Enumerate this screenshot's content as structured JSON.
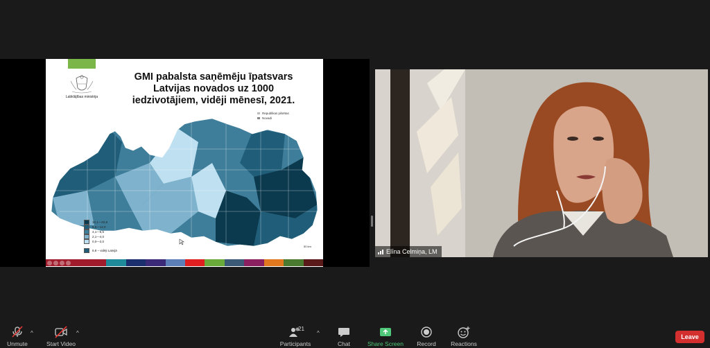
{
  "shared_screen": {
    "slide": {
      "ministry_name": "Labklājības ministrija",
      "title": "GMI pabalsta saņēmēju īpatsvars Latvijas novados uz 1000 iedzivotājiem, vidēji mēnesī, 2021.",
      "top_legend": [
        "Republikas pilsētas",
        "Novadi"
      ],
      "bottom_legend": [
        {
          "label": "12,1—22,8",
          "color": "#0b3a4f"
        },
        {
          "label": "6,6—12,0",
          "color": "#1f5d79"
        },
        {
          "label": "4,1—6,5",
          "color": "#3f7e9a"
        },
        {
          "label": "2,1—4,0",
          "color": "#7fb3cd"
        },
        {
          "label": "0,0—2,0",
          "color": "#bfe0f0"
        }
      ],
      "average_label": "6,8 – vidēji Latvijā",
      "scale_label": "50 km",
      "strip_colors": [
        "#1f8a9a",
        "#1b2f6e",
        "#3b2a78",
        "#5c7fb8",
        "#e02020",
        "#6aaa3a",
        "#3a5a78",
        "#8a2060",
        "#e07820",
        "#4a7a30",
        "#5a1a1a"
      ]
    }
  },
  "video": {
    "participant_name": "Elīna Celmiņa, LM"
  },
  "toolbar": {
    "unmute_label": "Unmute",
    "start_video_label": "Start Video",
    "participants_label": "Participants",
    "participants_count": "21",
    "chat_label": "Chat",
    "share_screen_label": "Share Screen",
    "record_label": "Record",
    "reactions_label": "Reactions",
    "leave_label": "Leave"
  },
  "colors": {
    "share_accent": "#4fc87a",
    "leave": "#d32f2f",
    "background": "#1a1a1a"
  }
}
